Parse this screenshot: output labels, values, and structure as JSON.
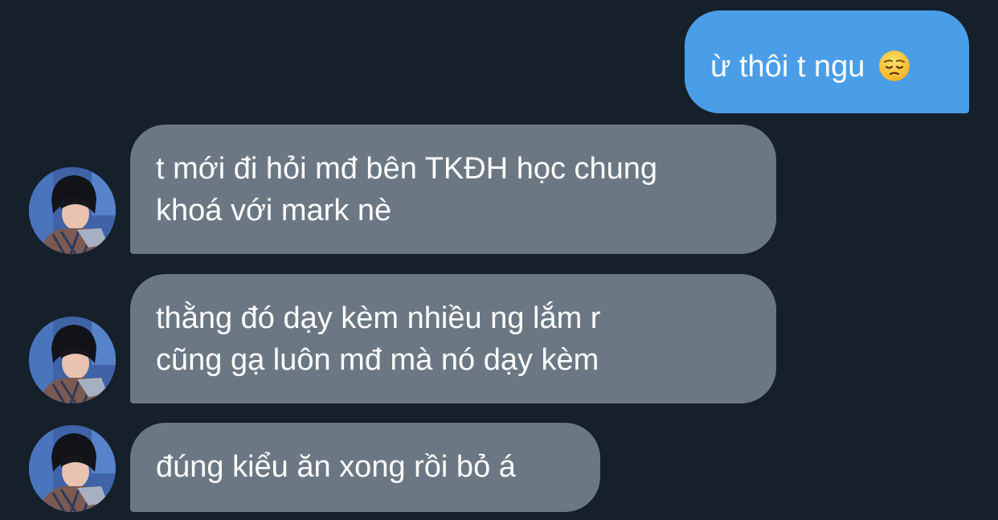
{
  "conversation": {
    "messages": [
      {
        "direction": "outgoing",
        "lines": [
          "ừ thôi t ngu"
        ],
        "emoji": "pensive-face-icon"
      },
      {
        "direction": "incoming",
        "lines": [
          "t mới đi hỏi mđ bên TKĐH học chung",
          "khoá với mark nè"
        ]
      },
      {
        "direction": "incoming",
        "lines": [
          "thằng đó dạy kèm nhiều ng lắm r",
          "cũng gạ luôn mđ mà nó dạy kèm"
        ]
      },
      {
        "direction": "incoming",
        "lines": [
          "đúng kiểu ăn xong rồi bỏ á"
        ]
      }
    ]
  },
  "theme": {
    "background": "#15202b",
    "outgoing_bubble": "#4a9ee8",
    "incoming_bubble": "#6b7884",
    "text": "#ffffff"
  }
}
